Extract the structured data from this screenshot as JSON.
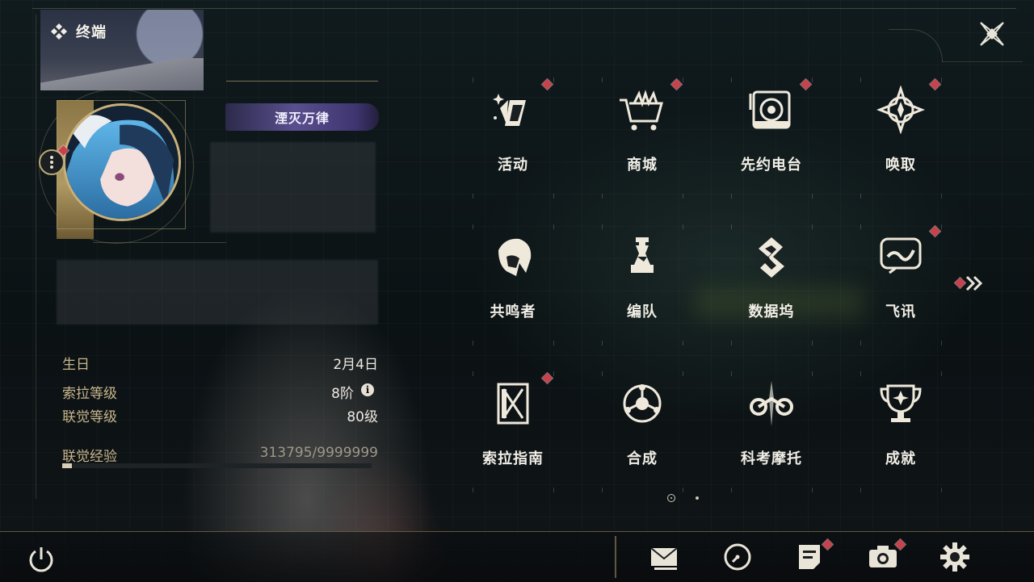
{
  "header": {
    "title": "终端",
    "close_icon": "close-icon"
  },
  "profile": {
    "title_badge": "湮灭万律",
    "avatar_icon": "avatar"
  },
  "stats": {
    "birthday_label": "生日",
    "birthday_value": "2月4日",
    "sola_level_label": "索拉等级",
    "sola_level_value": "8阶",
    "union_level_label": "联觉等级",
    "union_level_value": "80级",
    "union_exp_label": "联觉经验",
    "union_exp_value": "313795/9999999",
    "union_exp_progress": 0.0314
  },
  "menu": {
    "items": [
      {
        "label": "活动",
        "icon": "activity-icon",
        "badge": true
      },
      {
        "label": "商城",
        "icon": "shop-cart-icon",
        "badge": true
      },
      {
        "label": "先约电台",
        "icon": "radio-icon",
        "badge": true
      },
      {
        "label": "唤取",
        "icon": "convene-icon",
        "badge": true
      },
      {
        "label": "共鸣者",
        "icon": "resonator-icon",
        "badge": false
      },
      {
        "label": "编队",
        "icon": "team-chess-icon",
        "badge": false
      },
      {
        "label": "数据坞",
        "icon": "data-bank-icon",
        "badge": false
      },
      {
        "label": "飞讯",
        "icon": "message-icon",
        "badge": true
      },
      {
        "label": "索拉指南",
        "icon": "guide-icon",
        "badge": true
      },
      {
        "label": "合成",
        "icon": "synthesis-icon",
        "badge": false
      },
      {
        "label": "科考摩托",
        "icon": "motorcycle-icon",
        "badge": false
      },
      {
        "label": "成就",
        "icon": "trophy-icon",
        "badge": false
      }
    ],
    "page_count": 2,
    "current_page": 1
  },
  "bottom_bar": {
    "icons": [
      "power-icon",
      "mail-icon",
      "clock-icon",
      "notes-icon",
      "camera-icon",
      "settings-icon"
    ]
  },
  "colors": {
    "accent_gold": "#c8b68c",
    "badge_red": "#c8424e",
    "text_light": "#f1eee6"
  }
}
